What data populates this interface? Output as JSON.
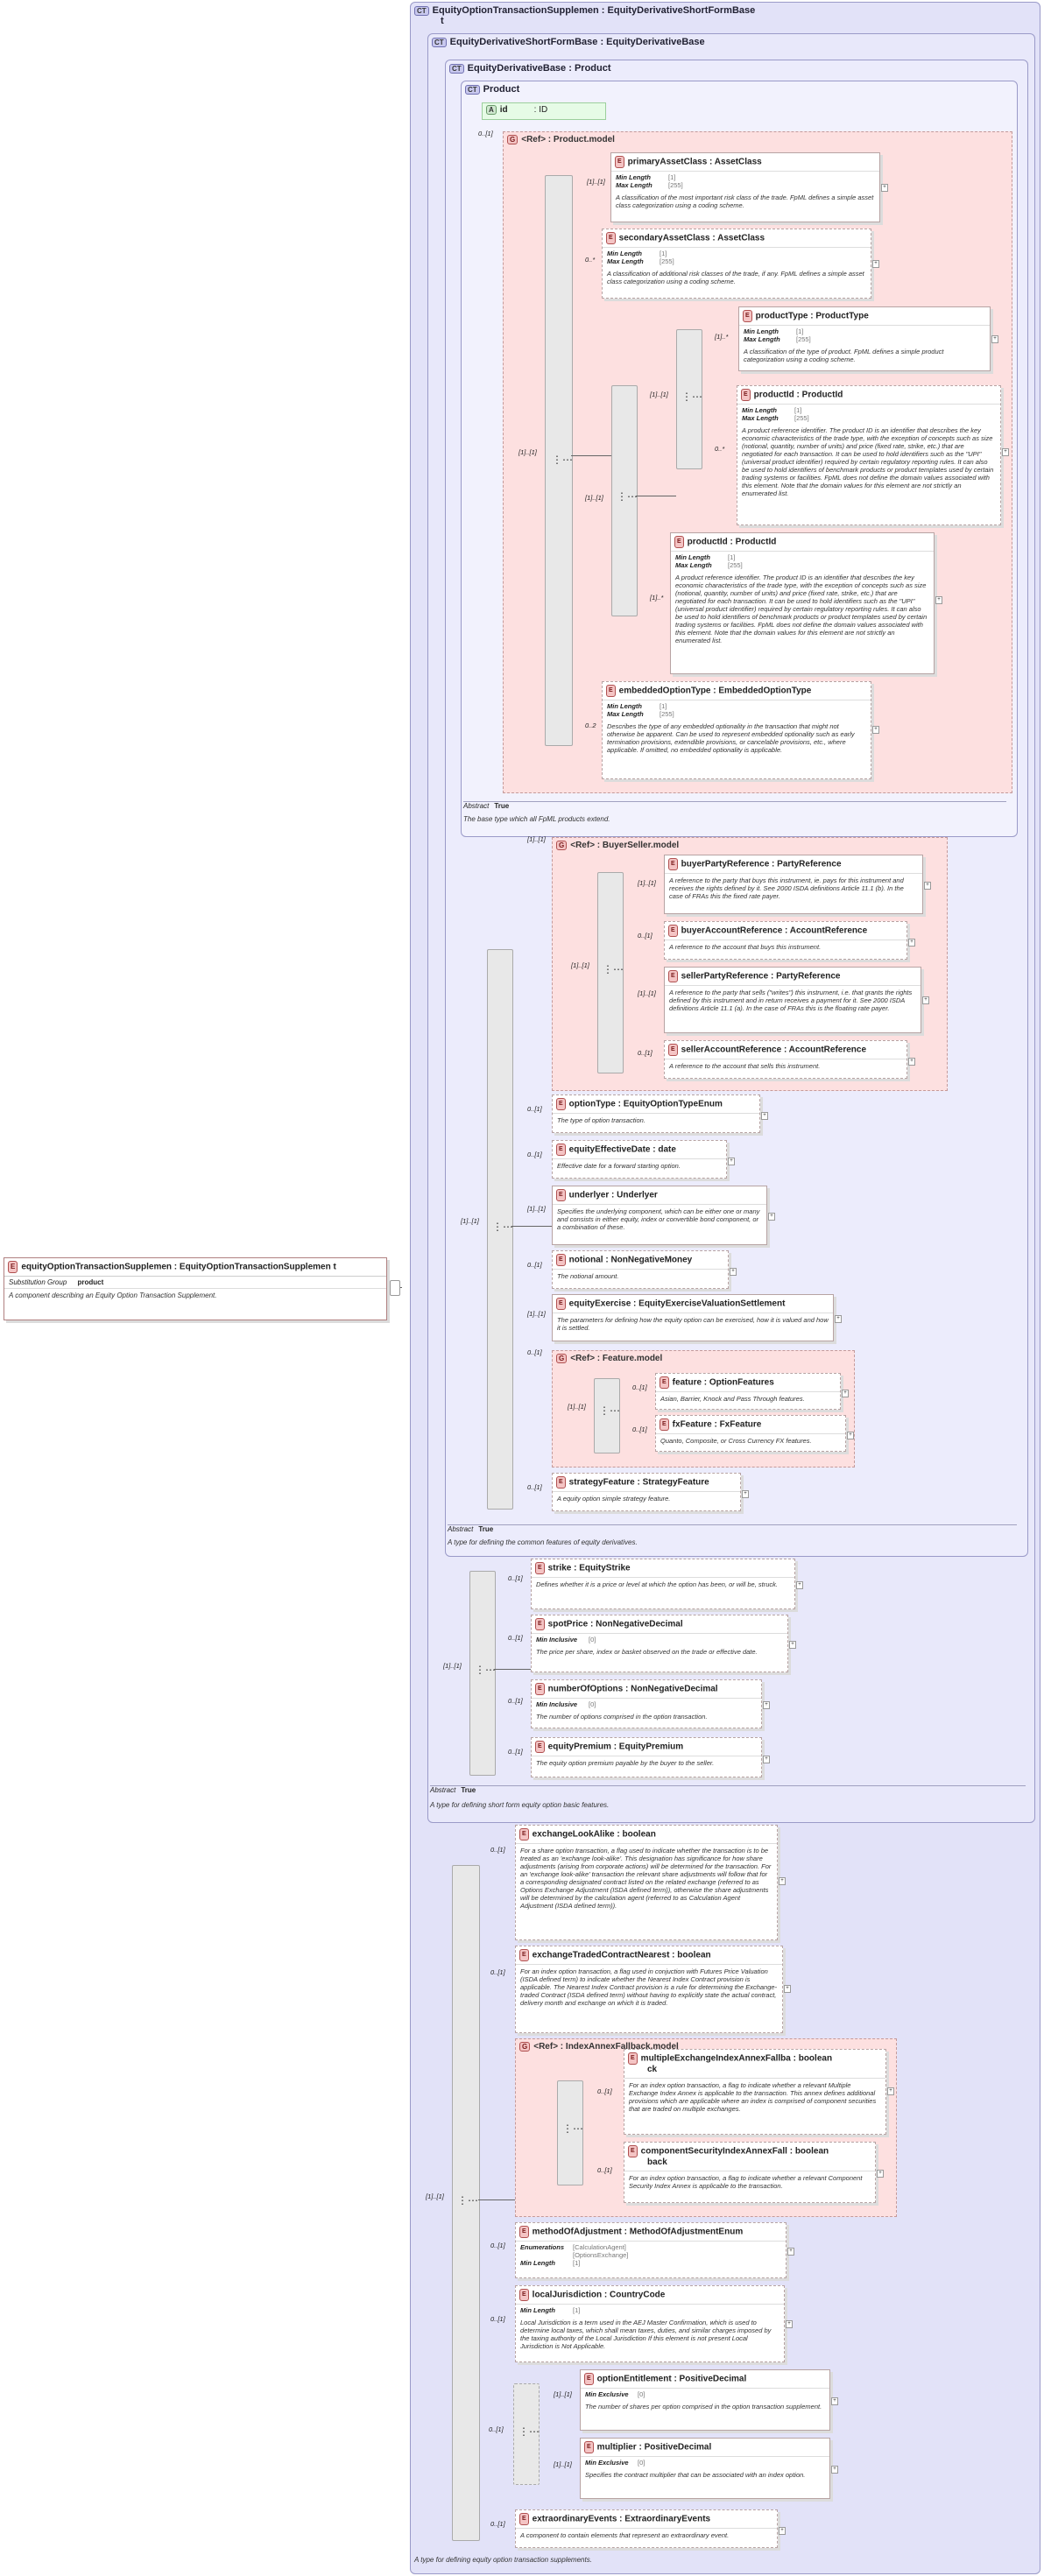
{
  "root": {
    "name": "equityOptionTransactionSupplemen : EquityOptionTransactionSupplemen t",
    "subst_label": "Substitution Group",
    "subst_value": "product",
    "desc": "A component describing an Equity Option Transaction Supplement."
  },
  "ct1": {
    "title": "EquityOptionTransactionSupplemen : EquityDerivativeShortFormBase",
    "title2": "t",
    "abstract_label": "",
    "desc": "A type for defining equity option transaction supplements."
  },
  "ct2": {
    "title": "EquityDerivativeShortFormBase : EquityDerivativeBase",
    "abstract_label": "Abstract",
    "abstract_value": "True",
    "desc": "A type for defining short form equity option basic features."
  },
  "ct3": {
    "title": "EquityDerivativeBase : Product",
    "abstract_label": "Abstract",
    "abstract_value": "True",
    "desc": "A type for defining the common features of equity derivatives."
  },
  "ct4": {
    "title": "Product",
    "abstract_label": "Abstract",
    "abstract_value": "True",
    "desc": "The base type which all FpML products extend."
  },
  "attr": {
    "name": "id",
    "type": ": ID"
  },
  "productModel": {
    "title": "<Ref>    : Product.model"
  },
  "buyerSellerModel": {
    "title": "<Ref>    : BuyerSeller.model"
  },
  "featureModel": {
    "title": "<Ref>    : Feature.model"
  },
  "indexAnnexModel": {
    "title": "<Ref>    : IndexAnnexFallback.model"
  },
  "elements": {
    "primaryAssetClass": {
      "name": "primaryAssetClass : AssetClass",
      "f1": "Min Length",
      "v1": "[1]",
      "f2": "Max Length",
      "v2": "[255]",
      "desc": "A classification of the most important risk class of the trade. FpML defines a simple asset class categorization using a coding scheme."
    },
    "secondaryAssetClass": {
      "name": "secondaryAssetClass : AssetClass",
      "f1": "Min Length",
      "v1": "[1]",
      "f2": "Max Length",
      "v2": "[255]",
      "desc": "A classification of additional risk classes of the trade, if any. FpML defines a simple asset class categorization using a coding scheme."
    },
    "productType": {
      "name": "productType : ProductType",
      "f1": "Min Length",
      "v1": "[1]",
      "f2": "Max Length",
      "v2": "[255]",
      "desc": "A classification of the type of product. FpML defines a simple product categorization using a coding scheme."
    },
    "productId1": {
      "name": "productId : ProductId",
      "f1": "Min Length",
      "v1": "[1]",
      "f2": "Max Length",
      "v2": "[255]",
      "desc": "A product reference identifier. The product ID is an identifier that describes the key economic characteristics of the trade type, with the exception of concepts such as size (notional, quantity, number of units) and price (fixed rate, strike, etc.) that are negotiated for each transaction. It can be used to hold identifiers such as the \"UPI\" (universal product identifier) required by certain regulatory reporting rules. It can also be used to hold identifiers of benchmark products or product templates used by certain trading systems or facilities. FpML does not define the domain values associated with this element. Note that the domain values for this element are not strictly an enumerated list."
    },
    "productId2": {
      "name": "productId : ProductId",
      "f1": "Min Length",
      "v1": "[1]",
      "f2": "Max Length",
      "v2": "[255]",
      "desc": "A product reference identifier. The product ID is an identifier that describes the key economic characteristics of the trade type, with the exception of concepts such as size (notional, quantity, number of units) and price (fixed rate, strike, etc.) that are negotiated for each transaction. It can be used to hold identifiers such as the \"UPI\" (universal product identifier) required by certain regulatory reporting rules. It can also be used to hold identifiers of benchmark products or product templates used by certain trading systems or facilities. FpML does not define the domain values associated with this element. Note that the domain values for this element are not strictly an enumerated list."
    },
    "embeddedOptionType": {
      "name": "embeddedOptionType : EmbeddedOptionType",
      "f1": "Min Length",
      "v1": "[1]",
      "f2": "Max Length",
      "v2": "[255]",
      "desc": "Describes the type of any embedded optionality in the transaction that might not otherwise be apparent. Can be used to represent embedded optionality such as early termination provisions, extendible provisions, or cancelable provisions, etc., where applicable. If omitted, no embedded optionality is applicable."
    },
    "buyerPartyReference": {
      "name": "buyerPartyReference : PartyReference",
      "desc": "A reference to the party that buys this instrument, ie. pays for this instrument and receives the rights defined by it. See 2000 ISDA definitions Article 11.1 (b). In the case of FRAs this the fixed rate payer."
    },
    "buyerAccountReference": {
      "name": "buyerAccountReference : AccountReference",
      "desc": "A reference to the account that buys this instrument."
    },
    "sellerPartyReference": {
      "name": "sellerPartyReference : PartyReference",
      "desc": "A reference to the party that sells (\"writes\") this instrument, i.e. that grants the rights defined by this instrument and in return receives a payment for it. See 2000 ISDA definitions Article 11.1 (a). In the case of FRAs this is the floating rate payer."
    },
    "sellerAccountReference": {
      "name": "sellerAccountReference : AccountReference",
      "desc": "A reference to the account that sells this instrument."
    },
    "optionType": {
      "name": "optionType : EquityOptionTypeEnum",
      "desc": "The type of option transaction."
    },
    "equityEffectiveDate": {
      "name": "equityEffectiveDate : date",
      "desc": "Effective date for a forward starting option."
    },
    "underlyer": {
      "name": "underlyer : Underlyer",
      "desc": "Specifies the underlying component, which can be either one or many and consists in either equity, index or convertible bond component, or a combination of these."
    },
    "notional": {
      "name": "notional : NonNegativeMoney",
      "desc": "The notional amount."
    },
    "equityExercise": {
      "name": "equityExercise : EquityExerciseValuationSettlement",
      "desc": "The parameters for defining how the equity option can be exercised, how it is valued and how it is settled."
    },
    "feature": {
      "name": "feature : OptionFeatures",
      "desc": "Asian, Barrier, Knock and Pass Through features."
    },
    "fxFeature": {
      "name": "fxFeature : FxFeature",
      "desc": "Quanto, Composite, or Cross Currency FX features."
    },
    "strategyFeature": {
      "name": "strategyFeature : StrategyFeature",
      "desc": "A equity option simple strategy feature."
    },
    "strike": {
      "name": "strike    : EquityStrike",
      "desc": "Defines whether it is a price or level at which the option has been, or will be, struck."
    },
    "spotPrice": {
      "name": "spotPrice : NonNegativeDecimal",
      "f1": "Min Inclusive",
      "v1": "[0]",
      "desc": "The price per share, index or basket observed on the trade or effective date."
    },
    "numberOfOptions": {
      "name": "numberOfOptions : NonNegativeDecimal",
      "f1": "Min Inclusive",
      "v1": "[0]",
      "desc": "The number of options comprised in the option transaction."
    },
    "equityPremium": {
      "name": "equityPremium : EquityPremium",
      "desc": "The equity option premium payable by the buyer to the seller."
    },
    "exchangeLookAlike": {
      "name": "exchangeLookAlike : boolean",
      "desc": "For a share option transaction, a flag used to indicate whether the transaction is to be treated as an 'exchange look-alike'. This designation has significance for how share adjustments (arising from corporate actions) will be determined for the transaction. For an 'exchange look-alike' transaction the relevant share adjustments will follow that for a corresponding designated contract listed on the related exchange (referred to as Options Exchange Adjustment (ISDA defined term)), otherwise the share adjustments will be determined by the calculation agent (referred to as Calculation Agent Adjustment (ISDA defined term))."
    },
    "exchangeTradedContractNearest": {
      "name": "exchangeTradedContractNearest : boolean",
      "desc": "For an index option transaction, a flag used in conjuction with Futures Price Valuation (ISDA defined term) to indicate whether the Nearest Index Contract provision is applicable. The Nearest Index Contract provision is a rule for determining the Exchange-traded Contract (ISDA defined term) without having to explicitly state the actual contract, delivery month and exchange on which it is traded."
    },
    "multipleExchangeIndexAnnexFallback": {
      "name": "multipleExchangeIndexAnnexFallba : boolean",
      "name2": "ck",
      "desc": "For an index option transaction, a flag to indicate whether a relevant Multiple Exchange Index Annex is applicable to the transaction. This annex defines additional provisions which are applicable where an index is comprised of component securities that are traded on multiple exchanges."
    },
    "componentSecurityIndexAnnexFallback": {
      "name": "componentSecurityIndexAnnexFall : boolean",
      "name2": "back",
      "desc": "For an index option transaction, a flag to indicate whether a relevant Component Security Index Annex is applicable to the transaction."
    },
    "methodOfAdjustment": {
      "name": "methodOfAdjustment : MethodOfAdjustmentEnum",
      "f1": "Enumerations",
      "v1": "[CalculationAgent]",
      "v1b": "[OptionsExchange]",
      "f2": "Min Length",
      "v2": "[1]"
    },
    "localJurisdiction": {
      "name": "localJurisdiction : CountryCode",
      "f1": "Min Length",
      "v1": "[1]",
      "desc": "Local Jurisdiction is a term used in the AEJ Master Confirmation, which is used to determine local taxes, which shall mean taxes, duties, and similar charges imposed by the taxing authority of the Local Jurisdiction If this element is not present Local Jurisdiction is Not Applicable."
    },
    "optionEntitlement": {
      "name": "optionEntitlement : PositiveDecimal",
      "f1": "Min Exclusive",
      "v1": "[0]",
      "desc": "The number of shares per option comprised in the option transaction supplement."
    },
    "multiplier": {
      "name": "multiplier : PositiveDecimal",
      "f1": "Min Exclusive",
      "v1": "[0]",
      "desc": "Specifies the contract multiplier that can be associated with an index option."
    },
    "extraordinaryEvents": {
      "name": "extraordinaryEvents : ExtraordinaryEvents",
      "desc": "A component to contain elements that represent an extraordinary event."
    }
  },
  "cards": {
    "c1_1": "[1]..[1]",
    "c0_1": "0..[1]",
    "c0_n": "0..*",
    "c1_n": "[1]..*",
    "c0_2": "0..2"
  },
  "icons": {
    "complex_type": "CT",
    "element": "E",
    "group": "G",
    "attribute": "A",
    "sequence": "sequence-icon",
    "choice": "choice-icon"
  }
}
